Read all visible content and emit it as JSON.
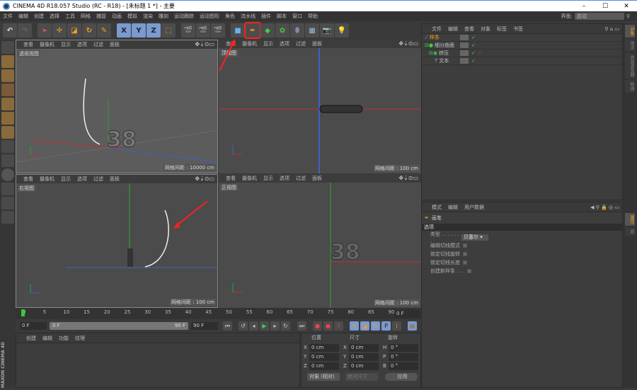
{
  "window": {
    "title": "CINEMA 4D R18.057 Studio (RC - R18) - [未标题 1 *] - 主要",
    "minimize": "–",
    "maximize": "☐",
    "close": "✕"
  },
  "menu": [
    "文件",
    "编辑",
    "创建",
    "选择",
    "工具",
    "网格",
    "捕捉",
    "动画",
    "模拟",
    "渲染",
    "雕刻",
    "运动跟踪",
    "运动图形",
    "角色",
    "流水线",
    "插件",
    "脚本",
    "窗口",
    "帮助"
  ],
  "layout": {
    "label": "界面:",
    "value": "启动"
  },
  "toolbar": {
    "x": "X",
    "y": "Y",
    "z": "Z"
  },
  "viewport_menu": [
    "查看",
    "摄像机",
    "显示",
    "选项",
    "过滤",
    "面板"
  ],
  "viewports": [
    {
      "label": "透视视图",
      "grid": "网格间距 : 10000 cm"
    },
    {
      "label": "顶视图",
      "grid": "网格间距 : 100 cm"
    },
    {
      "label": "右视图",
      "grid": "网格间距 : 100 cm"
    },
    {
      "label": "正视图",
      "grid": "网格间距 : 100 cm"
    }
  ],
  "model_text": "38",
  "object_manager": {
    "menu": [
      "文件",
      "编辑",
      "查看",
      "对象",
      "标签",
      "书签"
    ],
    "objects": [
      {
        "name": "样条",
        "selected": true
      },
      {
        "name": "细分曲面"
      },
      {
        "name": "挤压"
      },
      {
        "name": "文本"
      }
    ]
  },
  "right_tabs": [
    "对象",
    "场次",
    "内容浏览器",
    "构造",
    "属性",
    "层"
  ],
  "attributes": {
    "menu": [
      "模式",
      "编辑",
      "用户数据"
    ],
    "tool": "画笔",
    "section": "选项",
    "type_label": "类型 . . . . . . .",
    "type_value": "贝塞尔",
    "options": [
      "编辑切线模式",
      "锁定切线旋转",
      "锁定切线长度",
      "创建新样条 . . ."
    ]
  },
  "timeline": {
    "ticks": [
      "0",
      "5",
      "10",
      "15",
      "20",
      "25",
      "30",
      "35",
      "40",
      "45",
      "50",
      "55",
      "60",
      "65",
      "70",
      "75",
      "80",
      "85",
      "90"
    ],
    "current": "0 F",
    "current_frame": 0
  },
  "playback": {
    "start": "0 F",
    "range_start": "0 F",
    "range_end": "90 F",
    "end": "90 F"
  },
  "materials": {
    "menu": [
      "创建",
      "编辑",
      "功能",
      "纹理"
    ]
  },
  "coordinates": {
    "headers": [
      "位置",
      "尺寸",
      "旋转"
    ],
    "rows": [
      [
        "X",
        "0 cm",
        "X",
        "0 cm",
        "H",
        "0 °"
      ],
      [
        "Y",
        "0 cm",
        "Y",
        "0 cm",
        "P",
        "0 °"
      ],
      [
        "Z",
        "0 cm",
        "Z",
        "0 cm",
        "B",
        "0 °"
      ]
    ],
    "mode": "对象 (相对)",
    "size_mode": "绝对尺寸",
    "apply": "应用"
  },
  "brand": "MAXON CINEMA 4D",
  "colors": {
    "accent": "#f0a020",
    "annotation": "#ff2020",
    "x_axis": "#c03030",
    "y_axis": "#30a030",
    "z_axis": "#4060c0"
  }
}
